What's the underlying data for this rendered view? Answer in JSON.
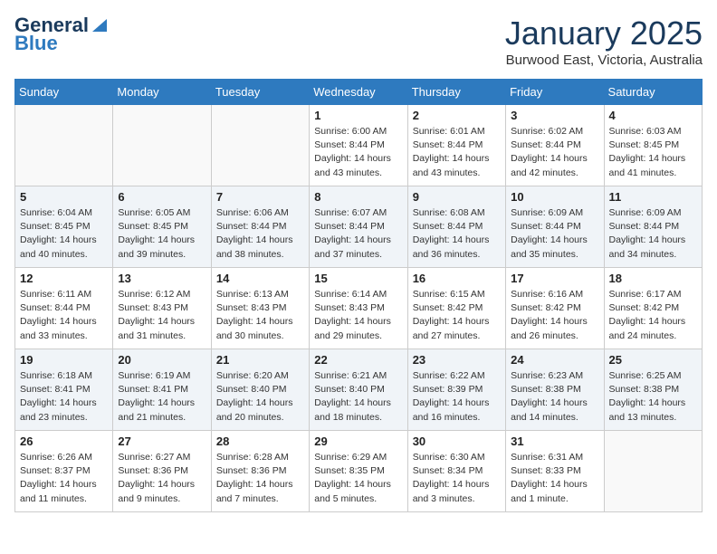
{
  "header": {
    "logo_general": "General",
    "logo_blue": "Blue",
    "month_title": "January 2025",
    "location": "Burwood East, Victoria, Australia"
  },
  "weekdays": [
    "Sunday",
    "Monday",
    "Tuesday",
    "Wednesday",
    "Thursday",
    "Friday",
    "Saturday"
  ],
  "weeks": [
    [
      {
        "day": "",
        "info": ""
      },
      {
        "day": "",
        "info": ""
      },
      {
        "day": "",
        "info": ""
      },
      {
        "day": "1",
        "info": "Sunrise: 6:00 AM\nSunset: 8:44 PM\nDaylight: 14 hours\nand 43 minutes."
      },
      {
        "day": "2",
        "info": "Sunrise: 6:01 AM\nSunset: 8:44 PM\nDaylight: 14 hours\nand 43 minutes."
      },
      {
        "day": "3",
        "info": "Sunrise: 6:02 AM\nSunset: 8:44 PM\nDaylight: 14 hours\nand 42 minutes."
      },
      {
        "day": "4",
        "info": "Sunrise: 6:03 AM\nSunset: 8:45 PM\nDaylight: 14 hours\nand 41 minutes."
      }
    ],
    [
      {
        "day": "5",
        "info": "Sunrise: 6:04 AM\nSunset: 8:45 PM\nDaylight: 14 hours\nand 40 minutes."
      },
      {
        "day": "6",
        "info": "Sunrise: 6:05 AM\nSunset: 8:45 PM\nDaylight: 14 hours\nand 39 minutes."
      },
      {
        "day": "7",
        "info": "Sunrise: 6:06 AM\nSunset: 8:44 PM\nDaylight: 14 hours\nand 38 minutes."
      },
      {
        "day": "8",
        "info": "Sunrise: 6:07 AM\nSunset: 8:44 PM\nDaylight: 14 hours\nand 37 minutes."
      },
      {
        "day": "9",
        "info": "Sunrise: 6:08 AM\nSunset: 8:44 PM\nDaylight: 14 hours\nand 36 minutes."
      },
      {
        "day": "10",
        "info": "Sunrise: 6:09 AM\nSunset: 8:44 PM\nDaylight: 14 hours\nand 35 minutes."
      },
      {
        "day": "11",
        "info": "Sunrise: 6:09 AM\nSunset: 8:44 PM\nDaylight: 14 hours\nand 34 minutes."
      }
    ],
    [
      {
        "day": "12",
        "info": "Sunrise: 6:11 AM\nSunset: 8:44 PM\nDaylight: 14 hours\nand 33 minutes."
      },
      {
        "day": "13",
        "info": "Sunrise: 6:12 AM\nSunset: 8:43 PM\nDaylight: 14 hours\nand 31 minutes."
      },
      {
        "day": "14",
        "info": "Sunrise: 6:13 AM\nSunset: 8:43 PM\nDaylight: 14 hours\nand 30 minutes."
      },
      {
        "day": "15",
        "info": "Sunrise: 6:14 AM\nSunset: 8:43 PM\nDaylight: 14 hours\nand 29 minutes."
      },
      {
        "day": "16",
        "info": "Sunrise: 6:15 AM\nSunset: 8:42 PM\nDaylight: 14 hours\nand 27 minutes."
      },
      {
        "day": "17",
        "info": "Sunrise: 6:16 AM\nSunset: 8:42 PM\nDaylight: 14 hours\nand 26 minutes."
      },
      {
        "day": "18",
        "info": "Sunrise: 6:17 AM\nSunset: 8:42 PM\nDaylight: 14 hours\nand 24 minutes."
      }
    ],
    [
      {
        "day": "19",
        "info": "Sunrise: 6:18 AM\nSunset: 8:41 PM\nDaylight: 14 hours\nand 23 minutes."
      },
      {
        "day": "20",
        "info": "Sunrise: 6:19 AM\nSunset: 8:41 PM\nDaylight: 14 hours\nand 21 minutes."
      },
      {
        "day": "21",
        "info": "Sunrise: 6:20 AM\nSunset: 8:40 PM\nDaylight: 14 hours\nand 20 minutes."
      },
      {
        "day": "22",
        "info": "Sunrise: 6:21 AM\nSunset: 8:40 PM\nDaylight: 14 hours\nand 18 minutes."
      },
      {
        "day": "23",
        "info": "Sunrise: 6:22 AM\nSunset: 8:39 PM\nDaylight: 14 hours\nand 16 minutes."
      },
      {
        "day": "24",
        "info": "Sunrise: 6:23 AM\nSunset: 8:38 PM\nDaylight: 14 hours\nand 14 minutes."
      },
      {
        "day": "25",
        "info": "Sunrise: 6:25 AM\nSunset: 8:38 PM\nDaylight: 14 hours\nand 13 minutes."
      }
    ],
    [
      {
        "day": "26",
        "info": "Sunrise: 6:26 AM\nSunset: 8:37 PM\nDaylight: 14 hours\nand 11 minutes."
      },
      {
        "day": "27",
        "info": "Sunrise: 6:27 AM\nSunset: 8:36 PM\nDaylight: 14 hours\nand 9 minutes."
      },
      {
        "day": "28",
        "info": "Sunrise: 6:28 AM\nSunset: 8:36 PM\nDaylight: 14 hours\nand 7 minutes."
      },
      {
        "day": "29",
        "info": "Sunrise: 6:29 AM\nSunset: 8:35 PM\nDaylight: 14 hours\nand 5 minutes."
      },
      {
        "day": "30",
        "info": "Sunrise: 6:30 AM\nSunset: 8:34 PM\nDaylight: 14 hours\nand 3 minutes."
      },
      {
        "day": "31",
        "info": "Sunrise: 6:31 AM\nSunset: 8:33 PM\nDaylight: 14 hours\nand 1 minute."
      },
      {
        "day": "",
        "info": ""
      }
    ]
  ]
}
